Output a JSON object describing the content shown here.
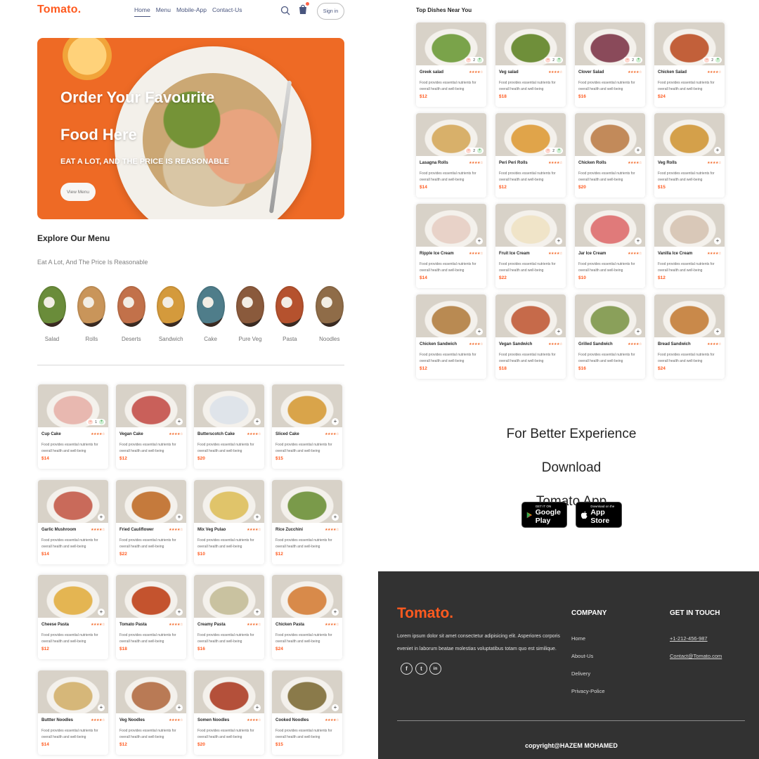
{
  "brand": {
    "logo": "Tomato.",
    "accent_color": "#ff5a1f"
  },
  "navbar": {
    "links": [
      "Home",
      "Menu",
      "Mobile-App",
      "Contact-Us"
    ],
    "active_link": "Home",
    "search_icon": "search-icon",
    "basket_icon": "basket-icon",
    "signin_label": "Sign in"
  },
  "hero": {
    "title_line1": "Order Your Favourite",
    "title_line2": "Food Here",
    "subtitle": "EAT A LOT, AND THE PRICE IS REASONABLE",
    "button_label": "View Menu"
  },
  "explore": {
    "title": "Explore Our Menu",
    "text": "Eat A Lot, And The Price Is Reasonable",
    "categories": [
      {
        "label": "Salad",
        "color": "#6a8c3a"
      },
      {
        "label": "Rolls",
        "color": "#c9955a"
      },
      {
        "label": "Deserts",
        "color": "#c2714a"
      },
      {
        "label": "Sandwich",
        "color": "#d49a3c"
      },
      {
        "label": "Cake",
        "color": "#4f7d8a"
      },
      {
        "label": "Pure Veg",
        "color": "#8a5a3c"
      },
      {
        "label": "Pasta",
        "color": "#b5522e"
      },
      {
        "label": "Noodles",
        "color": "#8f6c48"
      }
    ]
  },
  "food_list": [
    {
      "name": "Cup Cake",
      "price": "$14",
      "desc": "Food provides essential nutrients for overall health and well-being",
      "stars": "★★★★☆",
      "count": "1",
      "color": "#e8b8b0"
    },
    {
      "name": "Vegan Cake",
      "price": "$12",
      "desc": "Food provides essential nutrients for overall health and well-being",
      "stars": "★★★★☆",
      "count": "",
      "color": "#c9605a"
    },
    {
      "name": "Butterscotch Cake",
      "price": "$20",
      "desc": "Food provides essential nutrients for overall health and well-being",
      "stars": "★★★★☆",
      "count": "",
      "color": "#dfe4ea"
    },
    {
      "name": "Sliced Cake",
      "price": "$15",
      "desc": "Food provides essential nutrients for overall health and well-being",
      "stars": "★★★★☆",
      "count": "",
      "color": "#d9a44a"
    },
    {
      "name": "Garlic Mushroom",
      "price": "$14",
      "desc": "Food provides essential nutrients for overall health and well-being",
      "stars": "★★★★☆",
      "count": "",
      "color": "#c96a5a"
    },
    {
      "name": "Fried Cauliflower",
      "price": "$22",
      "desc": "Food provides essential nutrients for overall health and well-being",
      "stars": "★★★★☆",
      "count": "",
      "color": "#c57a3c"
    },
    {
      "name": "Mix Veg Pulao",
      "price": "$10",
      "desc": "Food provides essential nutrients for overall health and well-being",
      "stars": "★★★★☆",
      "count": "",
      "color": "#e0c46a"
    },
    {
      "name": "Rice Zucchini",
      "price": "$12",
      "desc": "Food provides essential nutrients for overall health and well-being",
      "stars": "★★★★☆",
      "count": "",
      "color": "#7a9a4a"
    },
    {
      "name": "Cheese Pasta",
      "price": "$12",
      "desc": "Food provides essential nutrients for overall health and well-being",
      "stars": "★★★★☆",
      "count": "",
      "color": "#e4b552"
    },
    {
      "name": "Tomato Pasta",
      "price": "$18",
      "desc": "Food provides essential nutrients for overall health and well-being",
      "stars": "★★★★☆",
      "count": "",
      "color": "#c4532e"
    },
    {
      "name": "Creamy Pasta",
      "price": "$16",
      "desc": "Food provides essential nutrients for overall health and well-being",
      "stars": "★★★★☆",
      "count": "",
      "color": "#c9c2a0"
    },
    {
      "name": "Chicken Pasta",
      "price": "$24",
      "desc": "Food provides essential nutrients for overall health and well-being",
      "stars": "★★★★☆",
      "count": "",
      "color": "#d88a4a"
    },
    {
      "name": "Buttter Noodles",
      "price": "$14",
      "desc": "Food provides essential nutrients for overall health and well-being",
      "stars": "★★★★☆",
      "count": "",
      "color": "#d6b779"
    },
    {
      "name": "Veg Noodles",
      "price": "$12",
      "desc": "Food provides essential nutrients for overall health and well-being",
      "stars": "★★★★☆",
      "count": "",
      "color": "#b97a55"
    },
    {
      "name": "Somen Noodles",
      "price": "$20",
      "desc": "Food provides essential nutrients for overall health and well-being",
      "stars": "★★★★☆",
      "count": "",
      "color": "#b4503a"
    },
    {
      "name": "Cooked Noodles",
      "price": "$15",
      "desc": "Food provides essential nutrients for overall health and well-being",
      "stars": "★★★★☆",
      "count": "",
      "color": "#8a7a4a"
    }
  ],
  "top_dishes": {
    "title": "Top Dishes Near You",
    "items": [
      {
        "name": "Greek salad",
        "price": "$12",
        "desc": "Food provides essential nutrients for overall health and well-being",
        "stars": "★★★★☆",
        "count": "2",
        "color": "#7aa34a"
      },
      {
        "name": "Veg salad",
        "price": "$18",
        "desc": "Food provides essential nutrients for overall health and well-being",
        "stars": "★★★★☆",
        "count": "2",
        "color": "#6f8f3a"
      },
      {
        "name": "Clover Salad",
        "price": "$16",
        "desc": "Food provides essential nutrients for overall health and well-being",
        "stars": "★★★★☆",
        "count": "2",
        "color": "#8a4a5a"
      },
      {
        "name": "Chicken Salad",
        "price": "$24",
        "desc": "Food provides essential nutrients for overall health and well-being",
        "stars": "★★★★☆",
        "count": "2",
        "color": "#c2603a"
      },
      {
        "name": "Lasagna Rolls",
        "price": "$14",
        "desc": "Food provides essential nutrients for overall health and well-being",
        "stars": "★★★★☆",
        "count": "2",
        "color": "#d8b06a"
      },
      {
        "name": "Peri Peri Rolls",
        "price": "$12",
        "desc": "Food provides essential nutrients for overall health and well-being",
        "stars": "★★★★☆",
        "count": "2",
        "color": "#e0a44a"
      },
      {
        "name": "Chicken Rolls",
        "price": "$20",
        "desc": "Food provides essential nutrients for overall health and well-being",
        "stars": "★★★★☆",
        "count": "",
        "color": "#c28a5a"
      },
      {
        "name": "Veg Rolls",
        "price": "$15",
        "desc": "Food provides essential nutrients for overall health and well-being",
        "stars": "★★★★☆",
        "count": "",
        "color": "#d4a04a"
      },
      {
        "name": "Ripple Ice Cream",
        "price": "$14",
        "desc": "Food provides essential nutrients for overall health and well-being",
        "stars": "★★★★☆",
        "count": "",
        "color": "#e8d2c8"
      },
      {
        "name": "Fruit Ice Cream",
        "price": "$22",
        "desc": "Food provides essential nutrients for overall health and well-being",
        "stars": "★★★★☆",
        "count": "",
        "color": "#f0e4c8"
      },
      {
        "name": "Jar Ice Cream",
        "price": "$10",
        "desc": "Food provides essential nutrients for overall health and well-being",
        "stars": "★★★★☆",
        "count": "",
        "color": "#e07a7a"
      },
      {
        "name": "Vanilla Ice Cream",
        "price": "$12",
        "desc": "Food provides essential nutrients for overall health and well-being",
        "stars": "★★★★☆",
        "count": "",
        "color": "#d9c8b8"
      },
      {
        "name": "Chicken Sandwich",
        "price": "$12",
        "desc": "Food provides essential nutrients for overall health and well-being",
        "stars": "★★★★☆",
        "count": "",
        "color": "#b98a52"
      },
      {
        "name": "Vegan Sandwich",
        "price": "$18",
        "desc": "Food provides essential nutrients for overall health and well-being",
        "stars": "★★★★☆",
        "count": "",
        "color": "#c66a4a"
      },
      {
        "name": "Grilled Sandwich",
        "price": "$16",
        "desc": "Food provides essential nutrients for overall health and well-being",
        "stars": "★★★★☆",
        "count": "",
        "color": "#8aa05a"
      },
      {
        "name": "Bread Sandwich",
        "price": "$24",
        "desc": "Food provides essential nutrients for overall health and well-being",
        "stars": "★★★★☆",
        "count": "",
        "color": "#c9894a"
      }
    ]
  },
  "app_download": {
    "line1": "For Better Experience Download",
    "line2": "Tomato App",
    "google_small": "GET IT ON",
    "google_big": "Google Play",
    "apple_small": "Download on the",
    "apple_big": "App Store"
  },
  "footer": {
    "logo": "Tomato.",
    "description": "Lorem ipsum dolor sit amet consectetur adipisicing elit. Asperiores corporis eveniet in laborum beatae molestias voluptatibus totam quo est similique.",
    "social": [
      "f",
      "t",
      "in"
    ],
    "company_title": "COMPANY",
    "company_links": [
      "Home",
      "About-Us",
      "Delivery",
      "Privacy-Police"
    ],
    "contact_title": "GET IN TOUCH",
    "phone": "+1-212-456-987",
    "email": "Contact@Tomato.com",
    "copyright": "copyright@HAZEM MOHAMED"
  }
}
